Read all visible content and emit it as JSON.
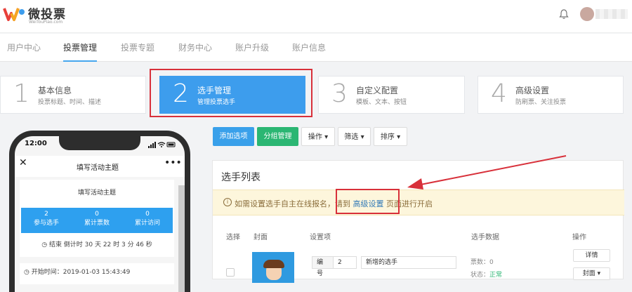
{
  "colors": {
    "primary": "#3d9ded",
    "green": "#2bb673",
    "highlight": "#d8303a"
  },
  "header": {
    "logo_text": "微投票",
    "logo_sub": "WeiTouPiao.com",
    "bell_icon": "bell-icon"
  },
  "nav": {
    "items": [
      {
        "label": "用户中心"
      },
      {
        "label": "投票管理",
        "active": true
      },
      {
        "label": "投票专题"
      },
      {
        "label": "财务中心"
      },
      {
        "label": "账户升级"
      },
      {
        "label": "账户信息"
      }
    ]
  },
  "steps": [
    {
      "num": "1",
      "title": "基本信息",
      "desc": "投票标题、时间、描述"
    },
    {
      "num": "2",
      "title": "选手管理",
      "desc": "管理投票选手",
      "active": true
    },
    {
      "num": "3",
      "title": "自定义配置",
      "desc": "模板、文本、按钮"
    },
    {
      "num": "4",
      "title": "高级设置",
      "desc": "防刷票、关注投票"
    }
  ],
  "phone": {
    "time": "12:00",
    "title": "填写活动主题",
    "close": "✕",
    "more": "•••",
    "topic": "填写活动主题",
    "stats": [
      {
        "value": "2",
        "label": "参与选手"
      },
      {
        "value": "0",
        "label": "累计票数"
      },
      {
        "value": "0",
        "label": "累计访问"
      }
    ],
    "countdown": "结束 倒计时 30 天 22 时 3 分 46 秒",
    "start_time": "开始时间：2019-01-03 15:43:49"
  },
  "toolbar": {
    "add": "添加选项",
    "group": "分组管理",
    "ops": "操作",
    "filter": "筛选",
    "sort": "排序"
  },
  "panel": {
    "title": "选手列表",
    "notice_pre": "如需设置选手自主在线报名，请到",
    "notice_link": "高级设置",
    "notice_post": "页面进行开启",
    "columns": [
      "选择",
      "封面",
      "设置项",
      "选手数据",
      "操作"
    ],
    "row": {
      "num_label": "编号",
      "num_value": "2",
      "name_value": "新增的选手",
      "votes": "票数：0",
      "status_label": "状态：",
      "status_value": "正常",
      "detail_btn": "详情",
      "cover_btn": "封面"
    }
  }
}
